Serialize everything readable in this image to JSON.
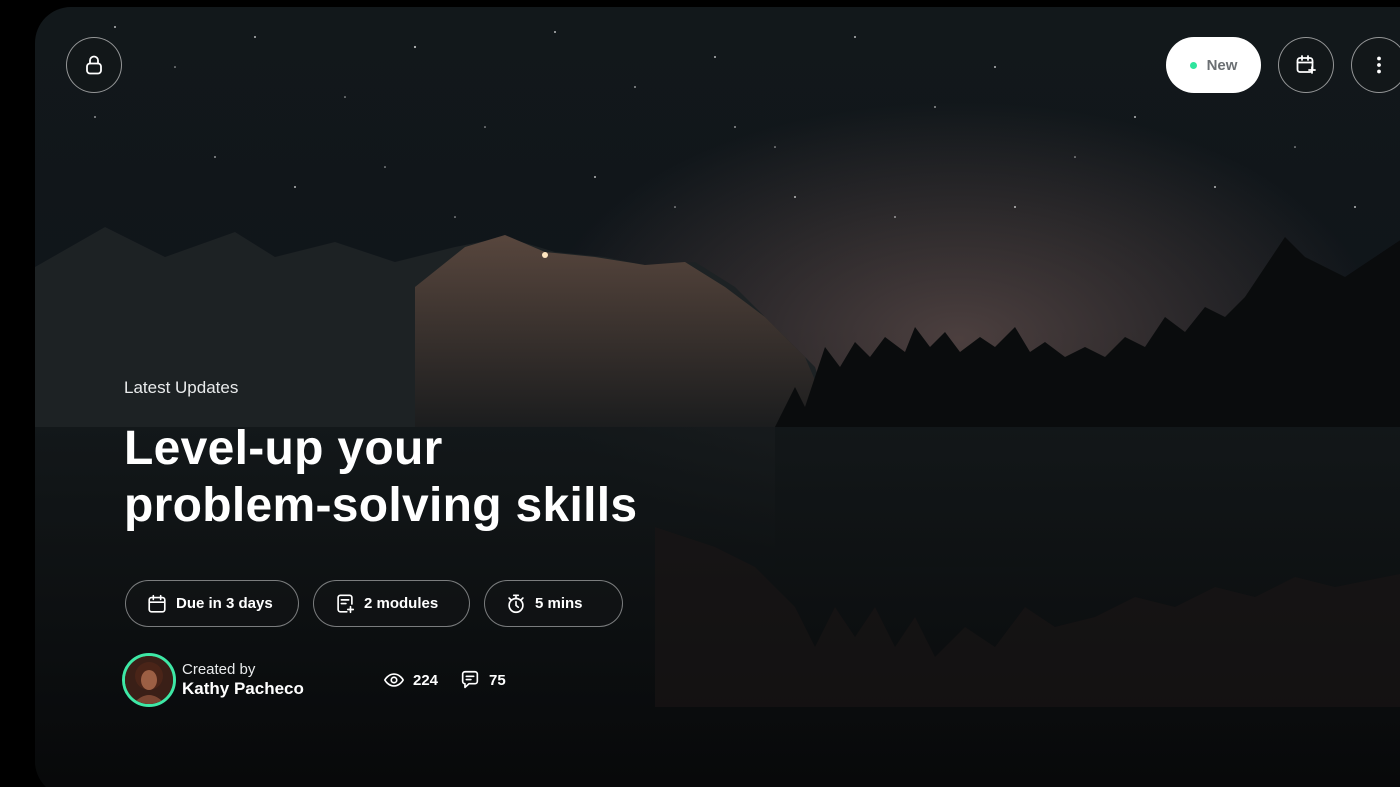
{
  "header": {
    "new_label": "New",
    "status_dot_color": "#2ee59d",
    "icons": [
      "lock-icon",
      "calendar-plus-icon",
      "more-vertical-icon"
    ]
  },
  "hero": {
    "eyebrow": "Latest Updates",
    "title_line1": "Level-up your",
    "title_line2": "problem-solving skills"
  },
  "chips": {
    "due": {
      "label": "Due in 3 days",
      "icon": "calendar-icon"
    },
    "modules": {
      "label": "2 modules",
      "icon": "document-add-icon"
    },
    "duration": {
      "label": "5 mins",
      "icon": "stopwatch-icon"
    }
  },
  "creator": {
    "label": "Created by",
    "name": "Kathy Pacheco",
    "avatar_ring_color": "#3ee8a6"
  },
  "stats": {
    "views": "224",
    "comments": "75"
  }
}
